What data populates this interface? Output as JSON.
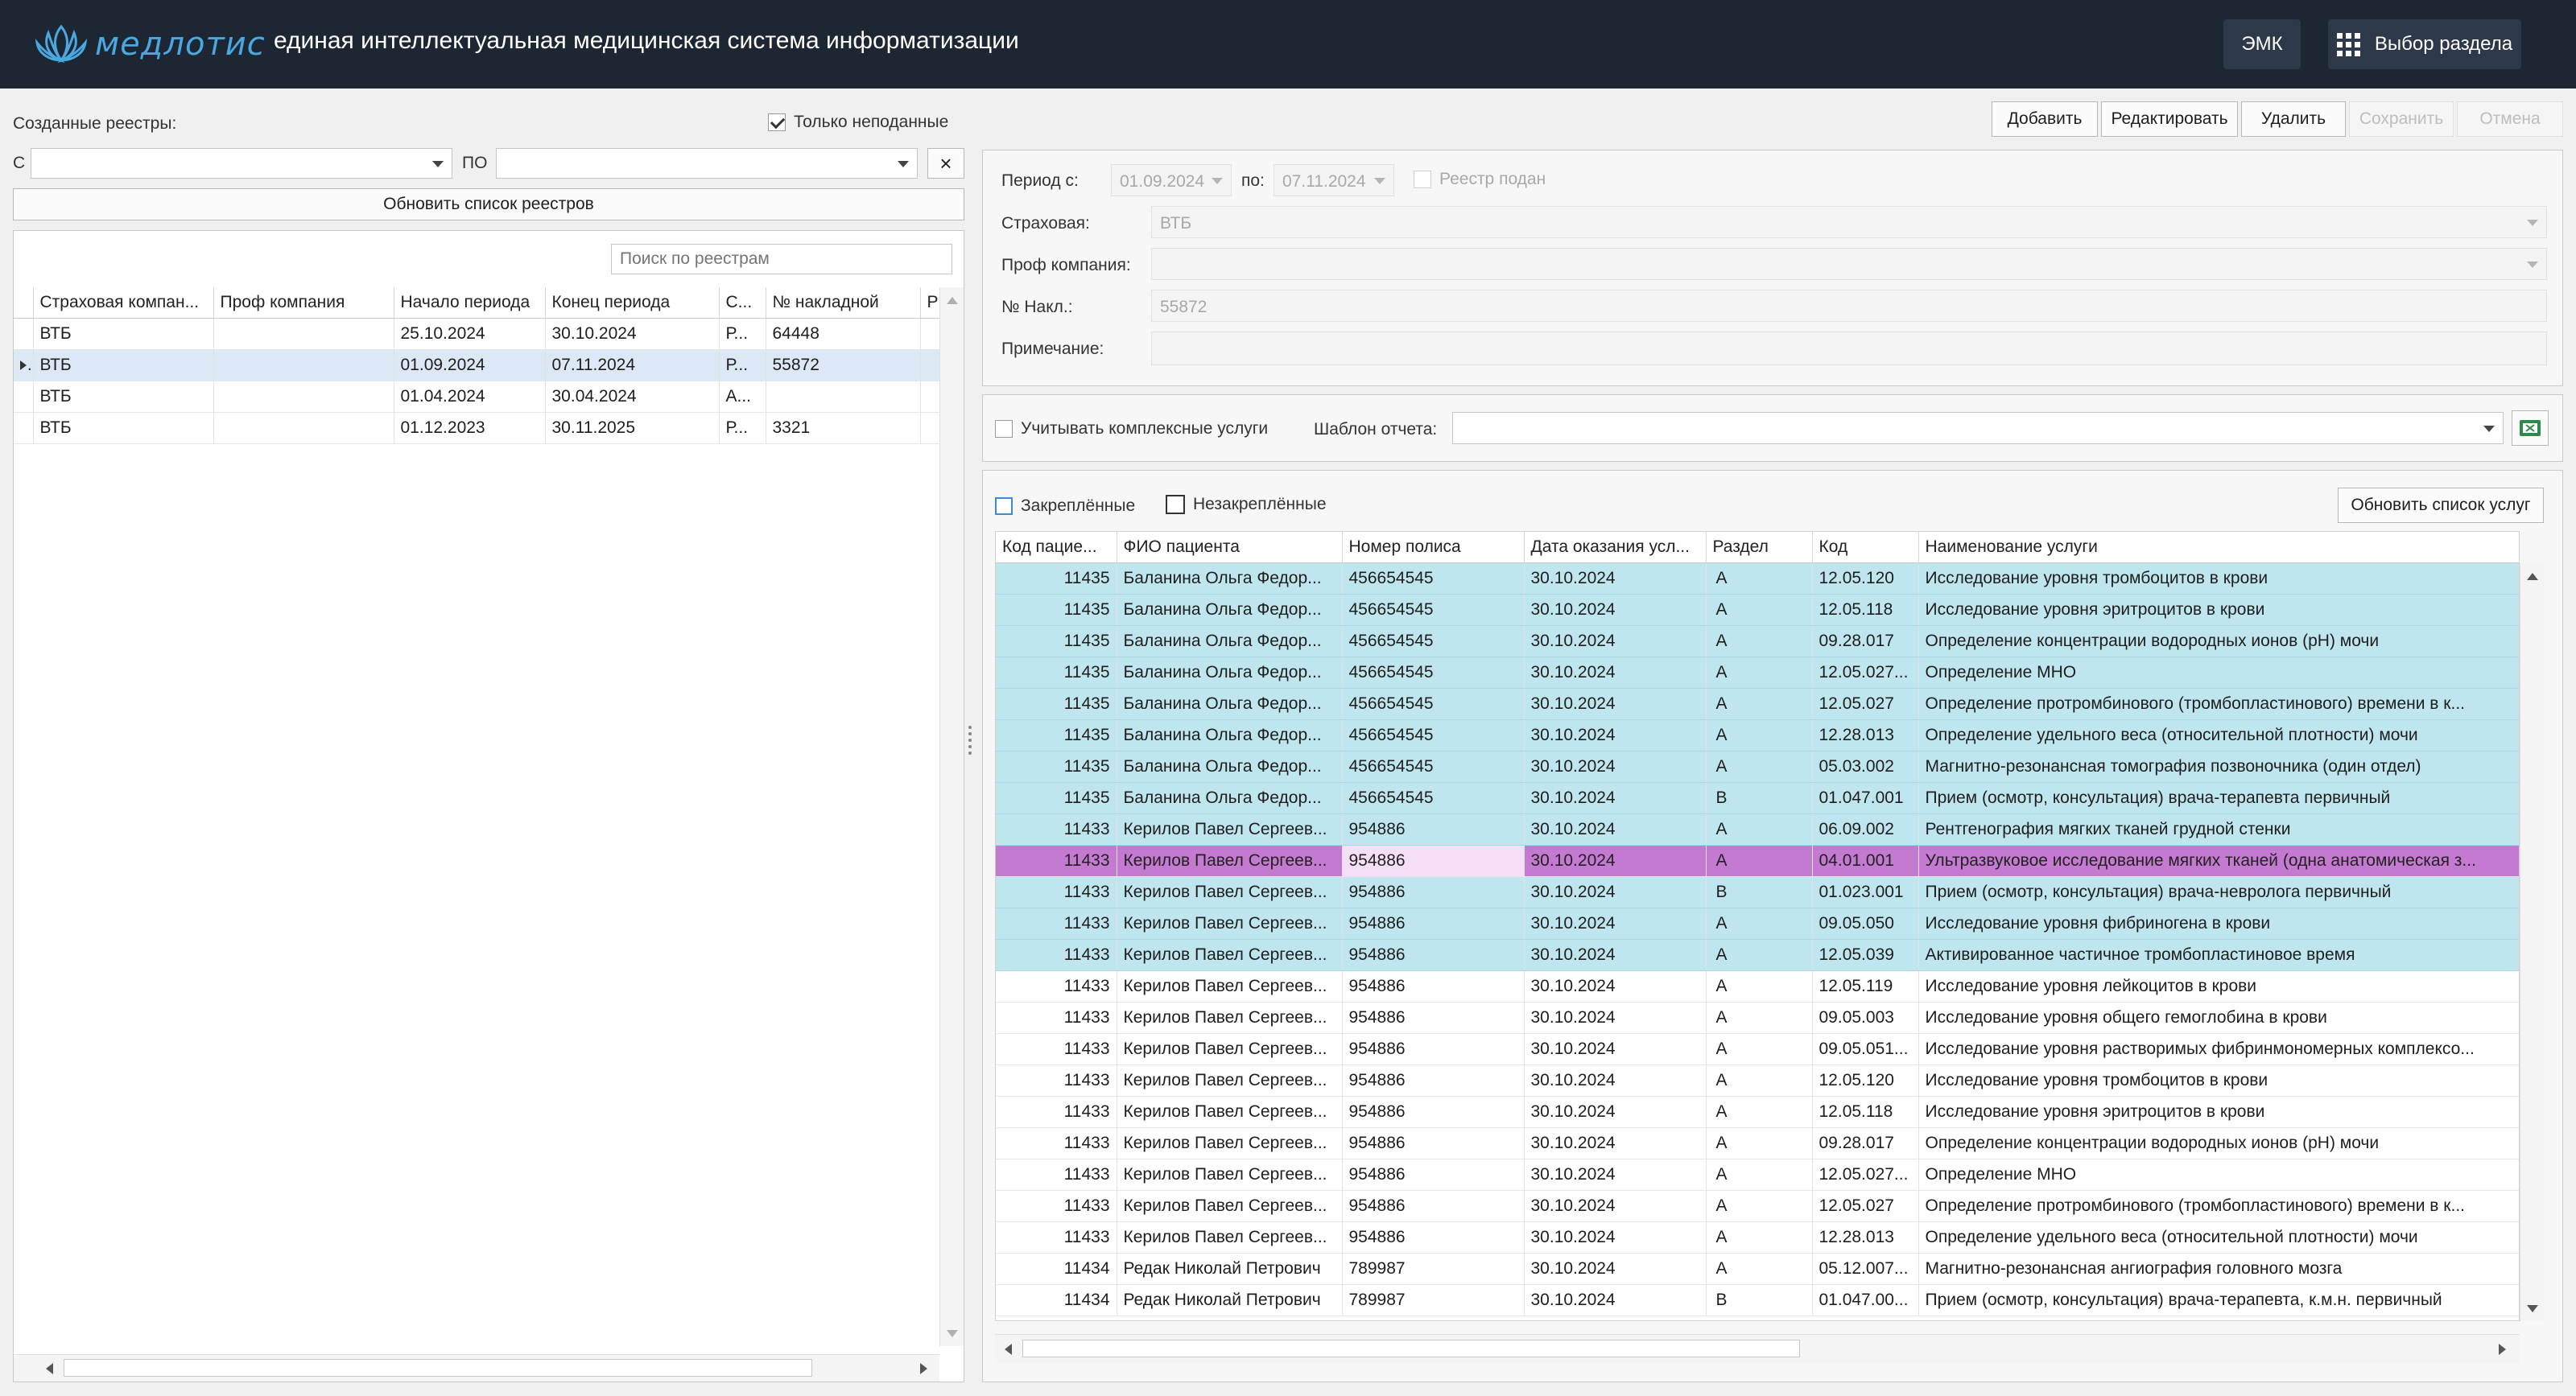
{
  "header": {
    "logo_text": "медлотис",
    "subtitle": "единая интеллектуальная медицинская система информатизации",
    "emk_label": "ЭМК",
    "section_label": "Выбор раздела"
  },
  "registries": {
    "title": "Созданные реестры:",
    "only_unsubmitted_label": "Только неподанные",
    "from_label": "С",
    "to_label": "ПО",
    "clear_label": "×",
    "refresh_label": "Обновить список реестров",
    "search_placeholder": "Поиск по реестрам",
    "columns": [
      "Страховая компан...",
      "Проф компания",
      "Начало периода",
      "Конец периода",
      "С...",
      "№ накладной",
      "Р"
    ],
    "rows": [
      [
        "ВТБ",
        "",
        "25.10.2024",
        "30.10.2024",
        "Р...",
        "64448"
      ],
      [
        "ВТБ",
        "",
        "01.09.2024",
        "07.11.2024",
        "Р...",
        "55872"
      ],
      [
        "ВТБ",
        "",
        "01.04.2024",
        "30.04.2024",
        "А...",
        ""
      ],
      [
        "ВТБ",
        "",
        "01.12.2023",
        "30.11.2025",
        "Р...",
        "3321"
      ]
    ]
  },
  "toolbar": {
    "add": "Добавить",
    "edit": "Редактировать",
    "delete": "Удалить",
    "save": "Сохранить",
    "cancel": "Отмена"
  },
  "form": {
    "period_from_label": "Период с:",
    "period_from": "01.09.2024",
    "period_to_label": "по:",
    "period_to": "07.11.2024",
    "submitted_label": "Реестр подан",
    "insurer_label": "Страховая:",
    "insurer": "ВТБ",
    "prof_label": "Проф компания:",
    "prof": "",
    "invoice_label": "№ Накл.:",
    "invoice": "55872",
    "note_label": "Примечание:",
    "note": ""
  },
  "report": {
    "complex_label": "Учитывать комплексные услуги",
    "template_label": "Шаблон отчета:",
    "template_value": ""
  },
  "services": {
    "pinned_label": "Закреплённые",
    "unpinned_label": "Незакреплённые",
    "refresh_label": "Обновить список услуг",
    "columns": [
      "Код пацие...",
      "ФИО пациента",
      "Номер полиса",
      "Дата оказания усл...",
      "Раздел",
      "Код",
      "Наименование услуги"
    ],
    "rows": [
      [
        "11435",
        "Баланина Ольга Федор...",
        "456654545",
        "30.10.2024",
        "A",
        "12.05.120",
        "Исследование уровня тромбоцитов в крови"
      ],
      [
        "11435",
        "Баланина Ольга Федор...",
        "456654545",
        "30.10.2024",
        "A",
        "12.05.118",
        "Исследование уровня эритроцитов в крови"
      ],
      [
        "11435",
        "Баланина Ольга Федор...",
        "456654545",
        "30.10.2024",
        "A",
        "09.28.017",
        "Определение концентрации водородных ионов (pH) мочи"
      ],
      [
        "11435",
        "Баланина Ольга Федор...",
        "456654545",
        "30.10.2024",
        "A",
        "12.05.027...",
        "Определение МНО"
      ],
      [
        "11435",
        "Баланина Ольга Федор...",
        "456654545",
        "30.10.2024",
        "A",
        "12.05.027",
        "Определение протромбинового (тромбопластинового) времени в к..."
      ],
      [
        "11435",
        "Баланина Ольга Федор...",
        "456654545",
        "30.10.2024",
        "A",
        "12.28.013",
        "Определение удельного веса (относительной плотности) мочи"
      ],
      [
        "11435",
        "Баланина Ольга Федор...",
        "456654545",
        "30.10.2024",
        "A",
        "05.03.002",
        "Магнитно-резонансная томография позвоночника (один отдел)"
      ],
      [
        "11435",
        "Баланина Ольга Федор...",
        "456654545",
        "30.10.2024",
        "B",
        "01.047.001",
        "Прием (осмотр, консультация) врача-терапевта первичный"
      ],
      [
        "11433",
        "Керилов Павел Сергеев...",
        "954886",
        "30.10.2024",
        "A",
        "06.09.002",
        "Рентгенография мягких тканей грудной стенки"
      ],
      [
        "11433",
        "Керилов Павел Сергеев...",
        "954886",
        "30.10.2024",
        "A",
        "04.01.001",
        "Ультразвуковое исследование мягких тканей (одна анатомическая з..."
      ],
      [
        "11433",
        "Керилов Павел Сергеев...",
        "954886",
        "30.10.2024",
        "B",
        "01.023.001",
        "Прием (осмотр, консультация) врача-невролога первичный"
      ],
      [
        "11433",
        "Керилов Павел Сергеев...",
        "954886",
        "30.10.2024",
        "A",
        "09.05.050",
        "Исследование уровня фибриногена в крови"
      ],
      [
        "11433",
        "Керилов Павел Сергеев...",
        "954886",
        "30.10.2024",
        "A",
        "12.05.039",
        "Активированное частичное тромбопластиновое время"
      ],
      [
        "11433",
        "Керилов Павел Сергеев...",
        "954886",
        "30.10.2024",
        "A",
        "12.05.119",
        "Исследование уровня лейкоцитов в крови"
      ],
      [
        "11433",
        "Керилов Павел Сергеев...",
        "954886",
        "30.10.2024",
        "A",
        "09.05.003",
        "Исследование уровня общего гемоглобина в крови"
      ],
      [
        "11433",
        "Керилов Павел Сергеев...",
        "954886",
        "30.10.2024",
        "A",
        "09.05.051...",
        "Исследование уровня растворимых фибринмономерных комплексо..."
      ],
      [
        "11433",
        "Керилов Павел Сергеев...",
        "954886",
        "30.10.2024",
        "A",
        "12.05.120",
        "Исследование уровня тромбоцитов в крови"
      ],
      [
        "11433",
        "Керилов Павел Сергеев...",
        "954886",
        "30.10.2024",
        "A",
        "12.05.118",
        "Исследование уровня эритроцитов в крови"
      ],
      [
        "11433",
        "Керилов Павел Сергеев...",
        "954886",
        "30.10.2024",
        "A",
        "09.28.017",
        "Определение концентрации водородных ионов (pH) мочи"
      ],
      [
        "11433",
        "Керилов Павел Сергеев...",
        "954886",
        "30.10.2024",
        "A",
        "12.05.027...",
        "Определение МНО"
      ],
      [
        "11433",
        "Керилов Павел Сергеев...",
        "954886",
        "30.10.2024",
        "A",
        "12.05.027",
        "Определение протромбинового (тромбопластинового) времени в к..."
      ],
      [
        "11433",
        "Керилов Павел Сергеев...",
        "954886",
        "30.10.2024",
        "A",
        "12.28.013",
        "Определение удельного веса (относительной плотности) мочи"
      ],
      [
        "11434",
        "Редак Николай Петрович",
        "789987",
        "30.10.2024",
        "A",
        "05.12.007...",
        "Магнитно-резонансная ангиография головного мозга"
      ],
      [
        "11434",
        "Редак Николай Петрович",
        "789987",
        "30.10.2024",
        "B",
        "01.047.00...",
        "Прием (осмотр, консультация) врача-терапевта, к.м.н. первичный"
      ]
    ],
    "row_styles": [
      "hl",
      "hl",
      "hl",
      "hl",
      "hl",
      "hl",
      "hl",
      "hl",
      "hl",
      "pink",
      "hl",
      "hl",
      "hl",
      "norm",
      "norm",
      "norm",
      "norm",
      "norm",
      "norm",
      "norm",
      "norm",
      "norm",
      "norm",
      "norm"
    ]
  },
  "colors": {
    "header_bg": "#1d2633",
    "highlight_row": "#bfe6ee",
    "selected_row": "#c57ad1",
    "logo": "#4aa8e0"
  }
}
